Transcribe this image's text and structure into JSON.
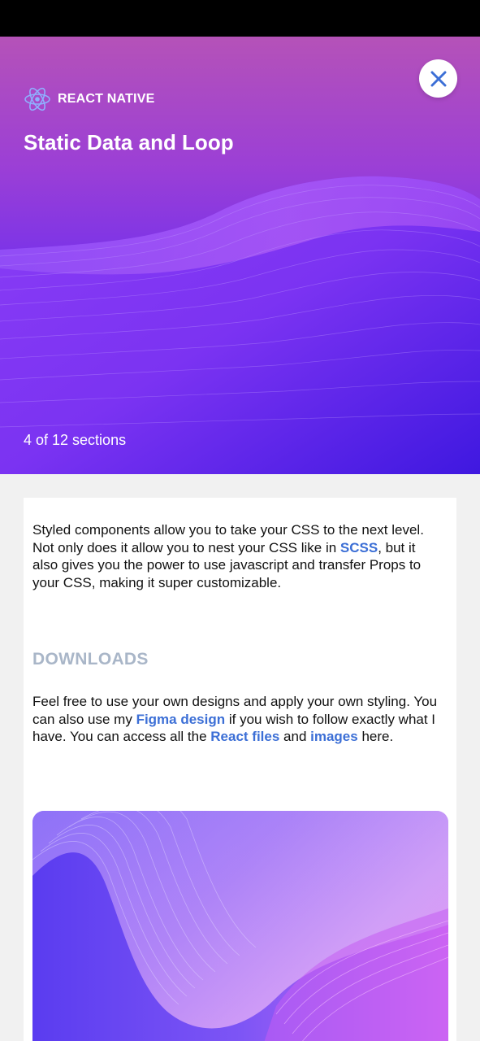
{
  "hero": {
    "category_label": "REACT NATIVE",
    "title": "Static Data and Loop",
    "progress_text": "4 of 12 sections",
    "close_icon": "close-icon",
    "category_icon": "react-icon"
  },
  "content": {
    "intro": {
      "part1": "Styled components allow you to take your CSS to the next level. Not only does it allow you to nest your CSS like in ",
      "link_scss": "SCSS",
      "part2": ", but it also gives you the power to use javascript and transfer Props to your CSS, making it super customizable."
    },
    "downloads_heading": "DOWNLOADS",
    "downloads": {
      "part1": "Feel free to use your own designs and apply your own styling. You can also use my ",
      "link_figma": "Figma design",
      "part2": " if you wish to follow exactly what I have. You can access all the ",
      "link_react_files": "React files",
      "part3": " and ",
      "link_images": "images",
      "part4": " here."
    }
  },
  "colors": {
    "link": "#3c6fd6",
    "heading_muted": "#a9b6c8",
    "hero_top": "#b552b8",
    "hero_bottom": "#4b1de6"
  }
}
